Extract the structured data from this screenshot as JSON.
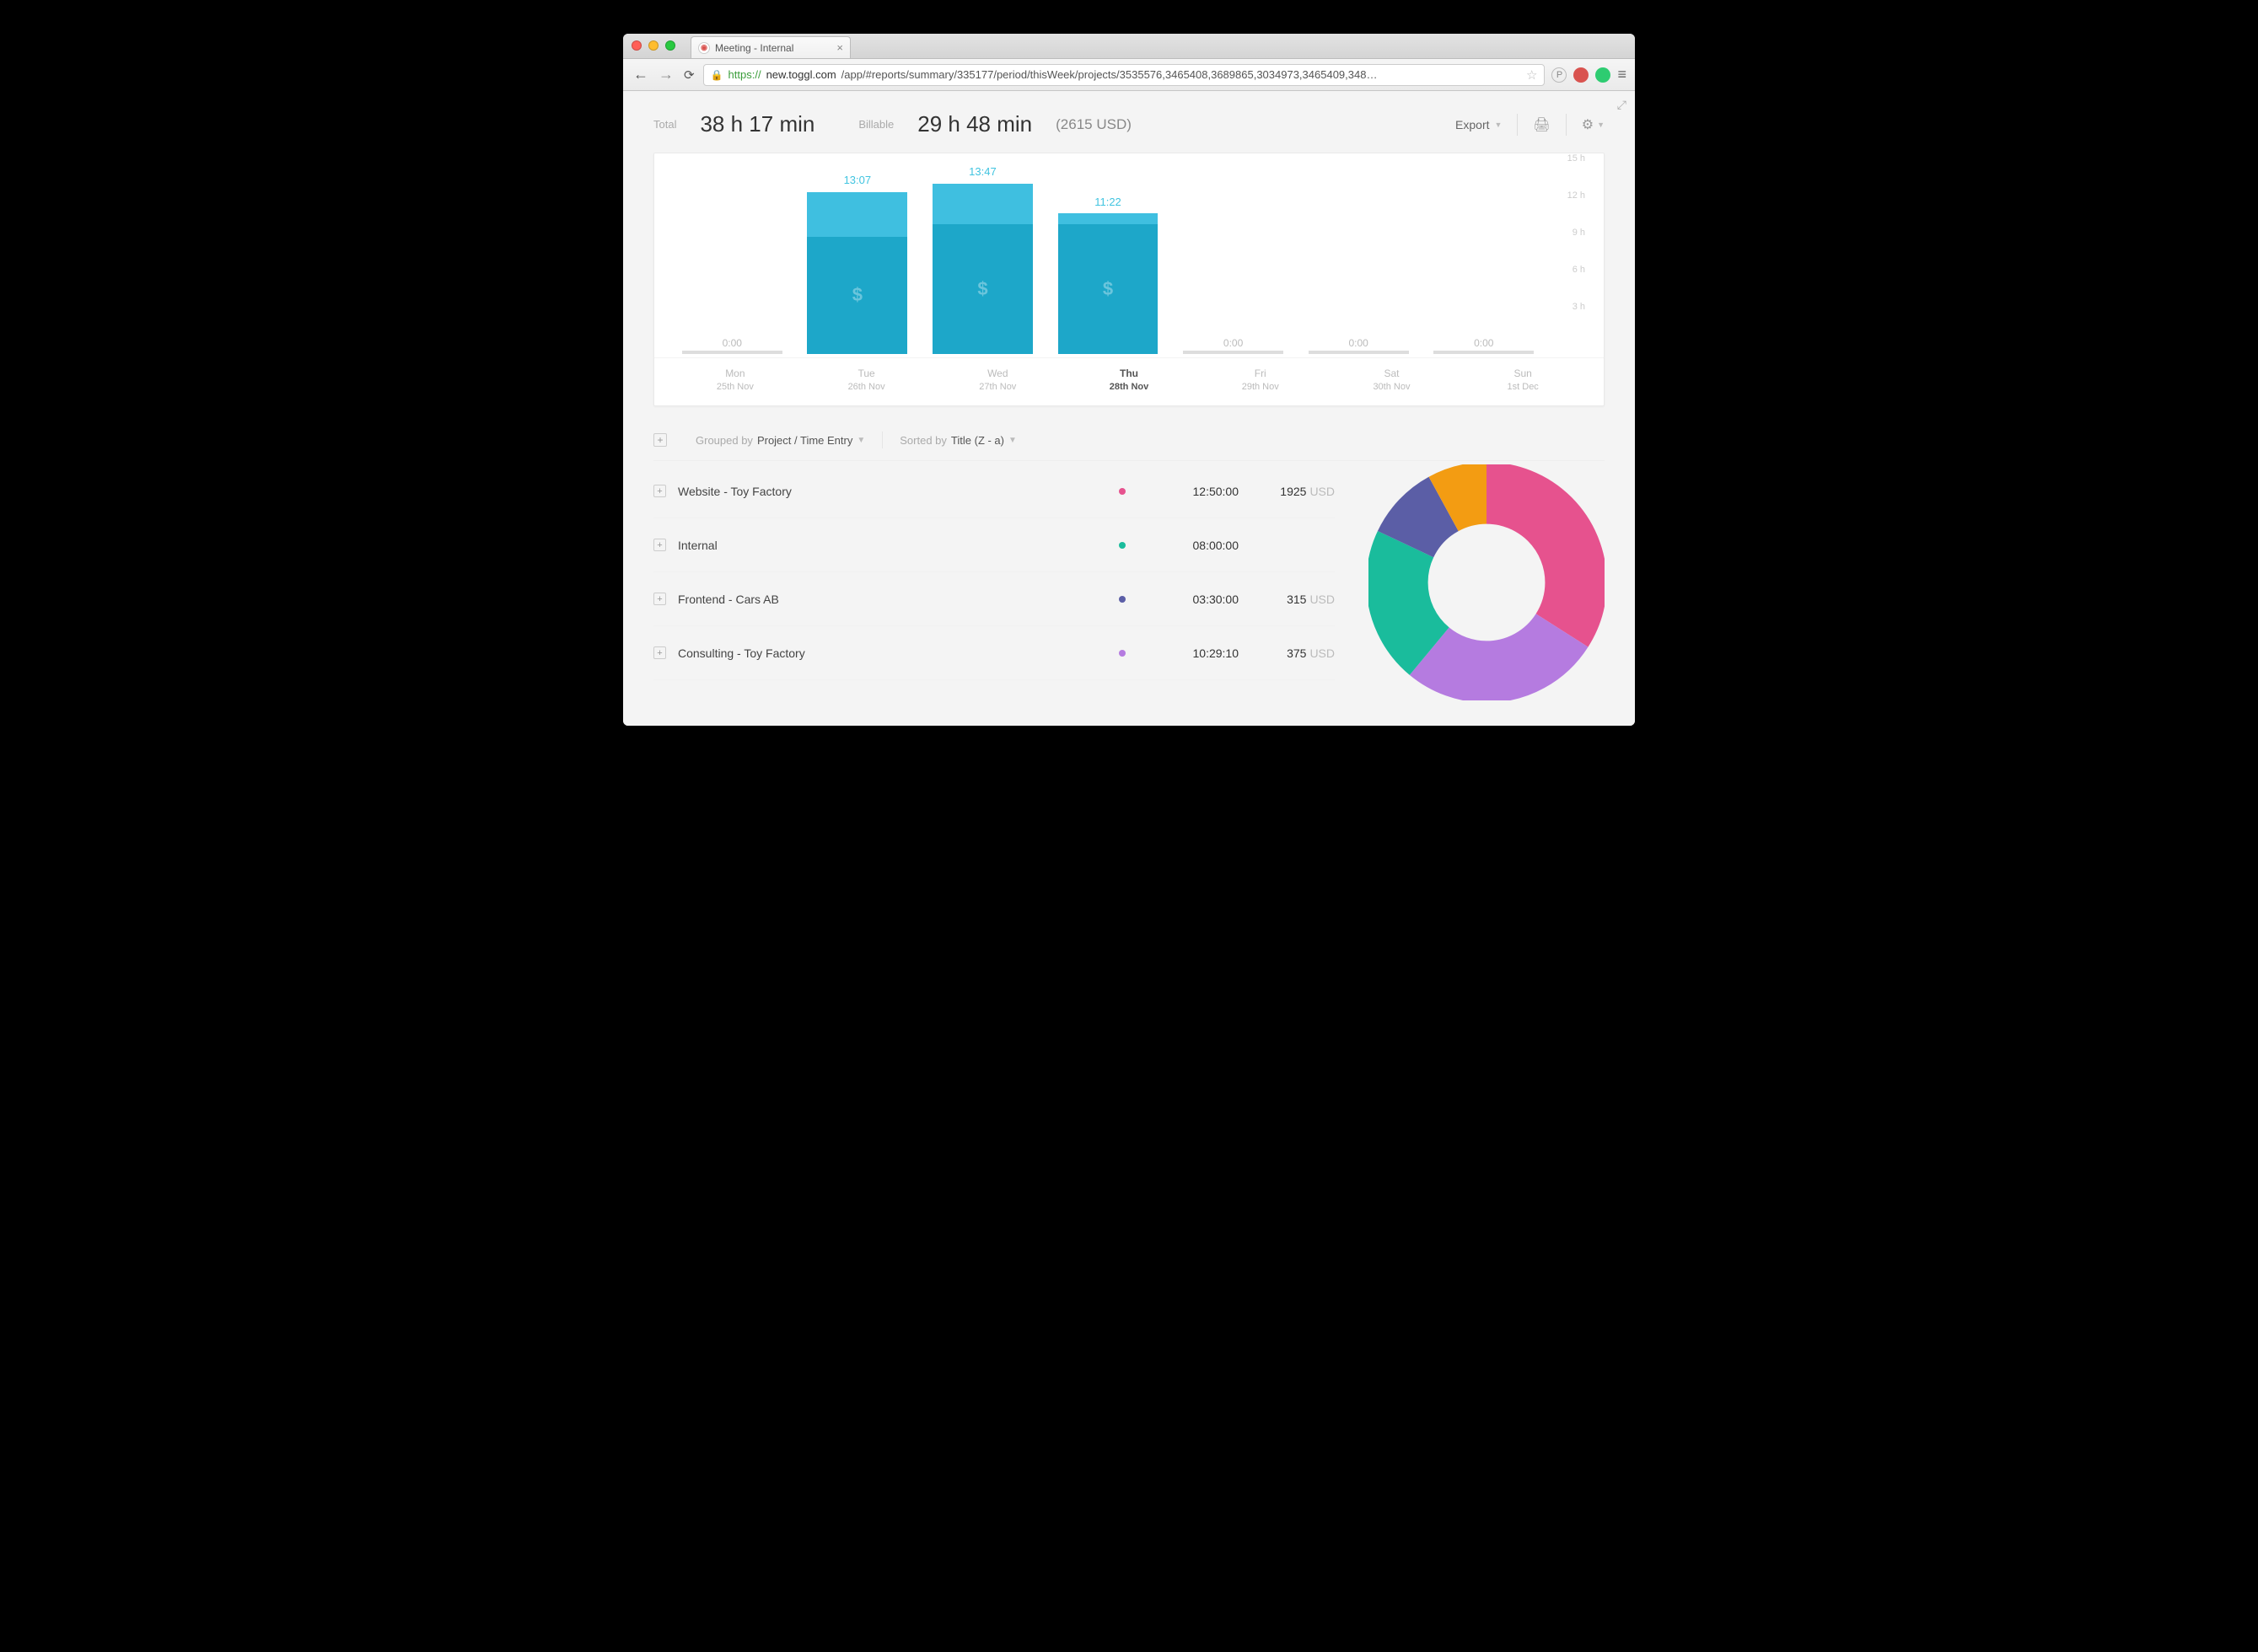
{
  "browser": {
    "tab_title": "Meeting - Internal",
    "url_scheme": "https://",
    "url_host": "new.toggl.com",
    "url_path": "/app/#reports/summary/335177/period/thisWeek/projects/3535576,3465408,3689865,3034973,3465409,348…"
  },
  "header": {
    "total_label": "Total",
    "total_value": "38 h 17 min",
    "billable_label": "Billable",
    "billable_value": "29 h 48 min",
    "billable_usd": "(2615 USD)",
    "export_label": "Export"
  },
  "controls": {
    "group_prefix": "Grouped by",
    "group_value": "Project / Time Entry",
    "sort_prefix": "Sorted by",
    "sort_value": "Title (Z - a)"
  },
  "chart_data": {
    "type": "bar",
    "ylabel": "hours",
    "ylim": [
      0,
      15
    ],
    "y_ticks": [
      "3 h",
      "6 h",
      "9 h",
      "12 h",
      "15 h"
    ],
    "categories": [
      {
        "day": "Mon",
        "date": "25th Nov",
        "selected": false
      },
      {
        "day": "Tue",
        "date": "26th Nov",
        "selected": false
      },
      {
        "day": "Wed",
        "date": "27th Nov",
        "selected": false
      },
      {
        "day": "Thu",
        "date": "28th Nov",
        "selected": true
      },
      {
        "day": "Fri",
        "date": "29th Nov",
        "selected": false
      },
      {
        "day": "Sat",
        "date": "30th Nov",
        "selected": false
      },
      {
        "day": "Sun",
        "date": "1st Dec",
        "selected": false
      }
    ],
    "bars": [
      {
        "label": "0:00",
        "total_h": 0,
        "billable_h": 0
      },
      {
        "label": "13:07",
        "total_h": 13.12,
        "billable_h": 9.5
      },
      {
        "label": "13:47",
        "total_h": 13.78,
        "billable_h": 10.5
      },
      {
        "label": "11:22",
        "total_h": 11.37,
        "billable_h": 10.5
      },
      {
        "label": "0:00",
        "total_h": 0,
        "billable_h": 0
      },
      {
        "label": "0:00",
        "total_h": 0,
        "billable_h": 0
      },
      {
        "label": "0:00",
        "total_h": 0,
        "billable_h": 0
      }
    ]
  },
  "projects": [
    {
      "name": "Website - Toy Factory",
      "color": "#e6528e",
      "duration": "12:50:00",
      "amount": "1925",
      "currency": "USD"
    },
    {
      "name": "Internal",
      "color": "#1abc9c",
      "duration": "08:00:00",
      "amount": "",
      "currency": ""
    },
    {
      "name": "Frontend - Cars AB",
      "color": "#5b5ea6",
      "duration": "03:30:00",
      "amount": "315",
      "currency": "USD"
    },
    {
      "name": "Consulting - Toy Factory",
      "color": "#b57be0",
      "duration": "10:29:10",
      "amount": "375",
      "currency": "USD"
    }
  ],
  "donut": {
    "slices": [
      {
        "color": "#e6528e",
        "value": 34
      },
      {
        "color": "#b57be0",
        "value": 27
      },
      {
        "color": "#1abc9c",
        "value": 21
      },
      {
        "color": "#5b5ea6",
        "value": 10
      },
      {
        "color": "#f39c12",
        "value": 8
      }
    ]
  }
}
